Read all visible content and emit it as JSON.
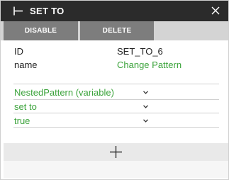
{
  "panel": {
    "title": "SET TO",
    "title_icon": "node-tee-icon",
    "close_icon": "close-icon"
  },
  "toolbar": {
    "disable_label": "DISABLE",
    "delete_label": "DELETE"
  },
  "properties": [
    {
      "key": "ID",
      "value": "SET_TO_6"
    },
    {
      "key": "name",
      "value": "Change Pattern"
    }
  ],
  "parameters": [
    {
      "label": "NestedPattern (variable)",
      "icon": "chevron-down-icon"
    },
    {
      "label": "set to",
      "icon": "chevron-down-icon"
    },
    {
      "label": "true",
      "icon": "chevron-down-icon"
    }
  ],
  "add_icon": "plus-icon",
  "colors": {
    "header_bg": "#2b2b2b",
    "button_bg": "#7d7d7d",
    "accent_green": "#3ba33b"
  }
}
